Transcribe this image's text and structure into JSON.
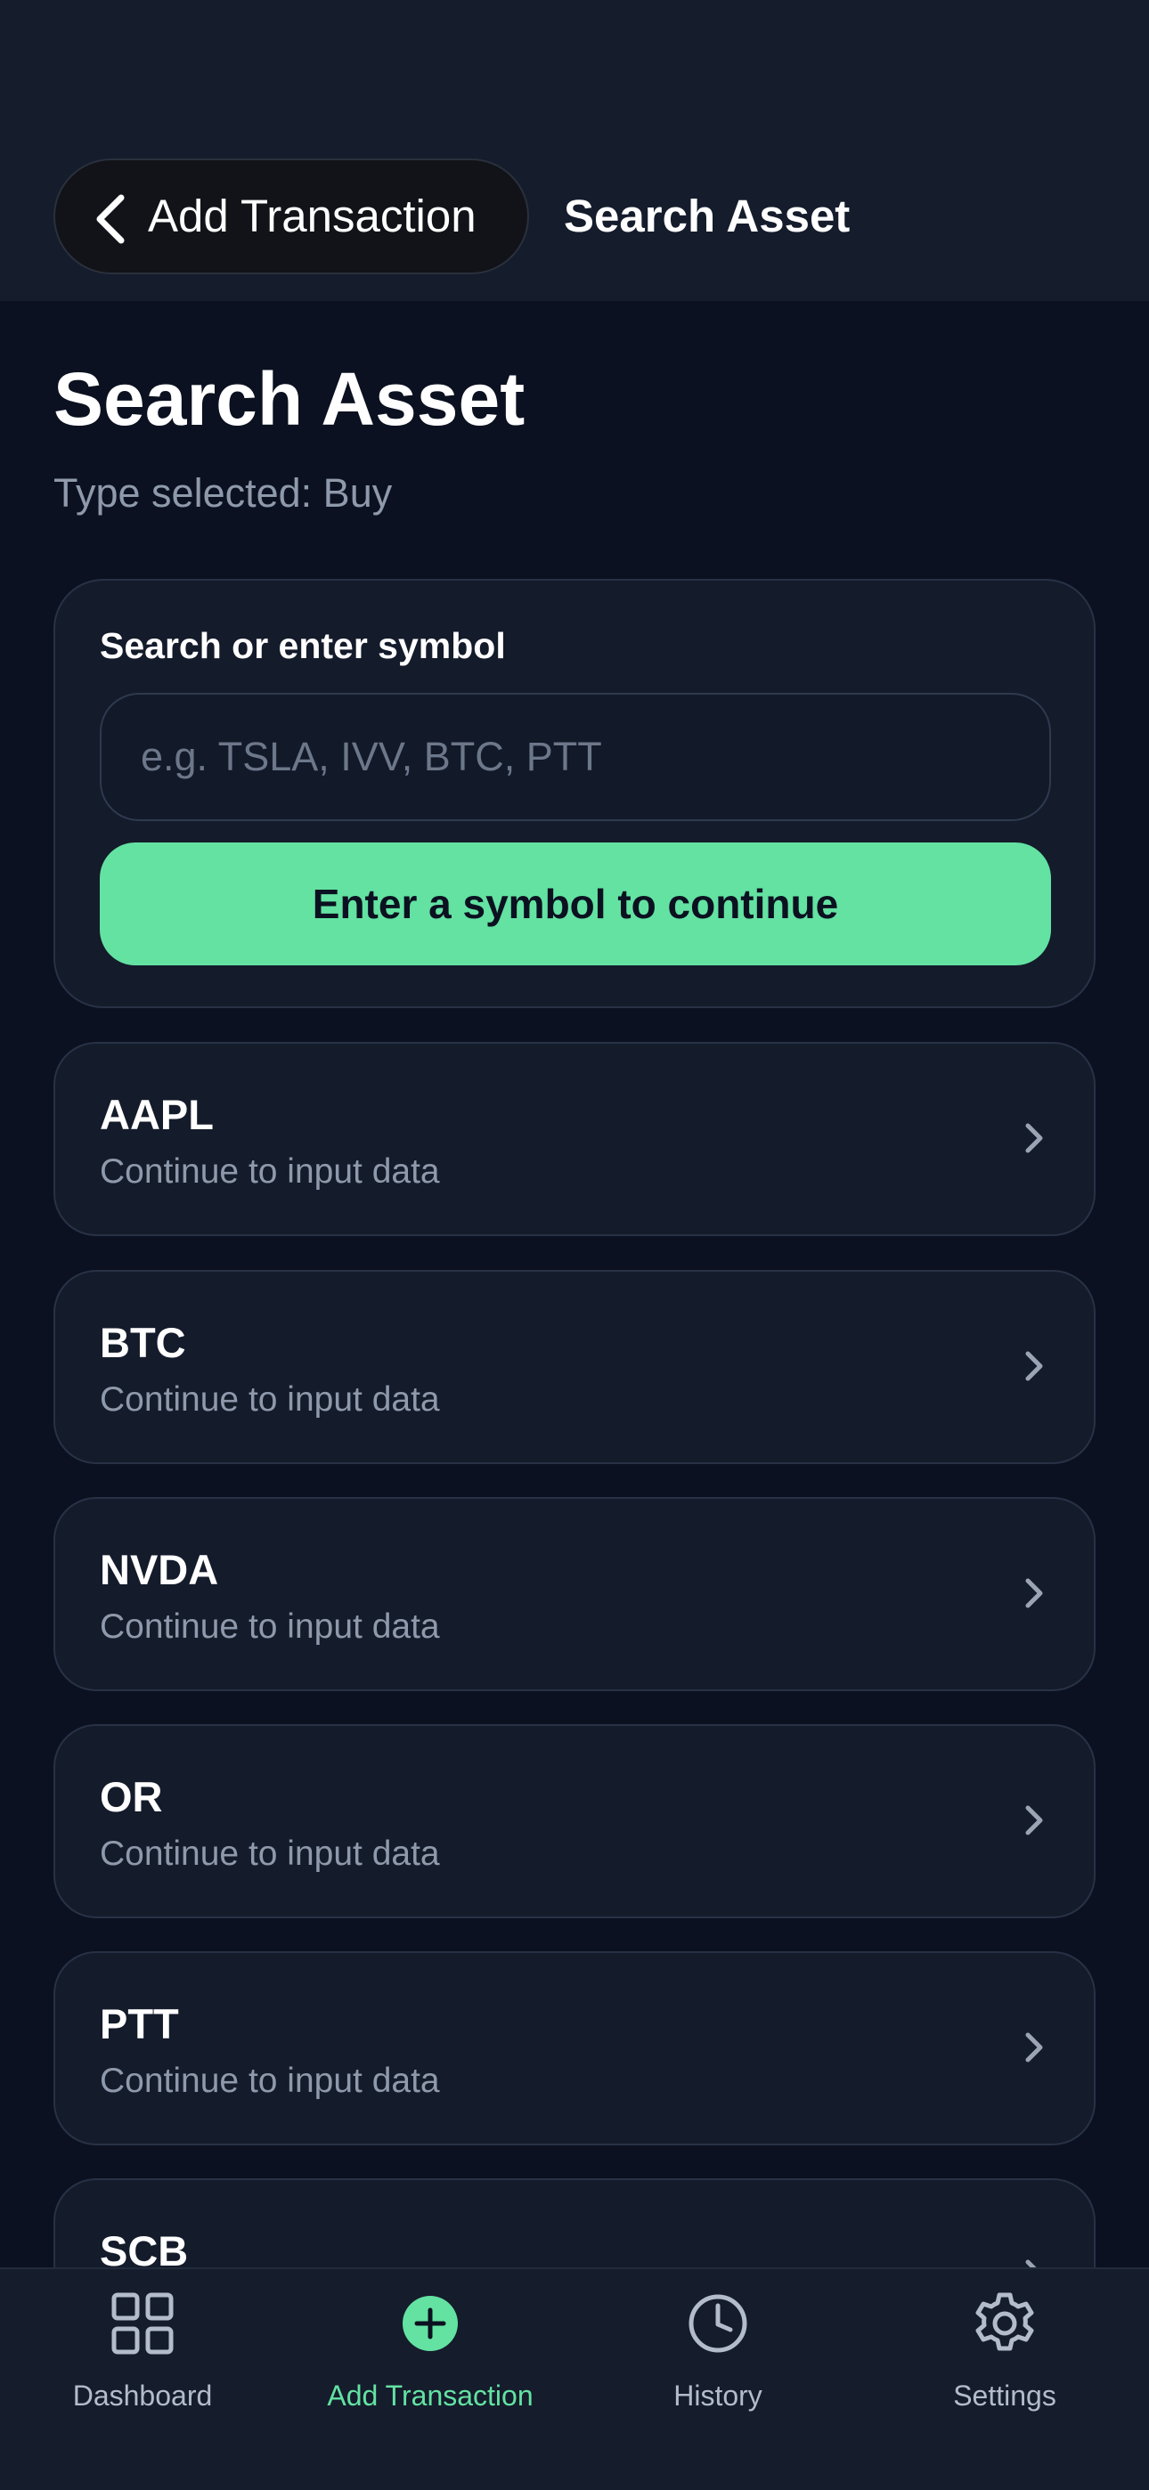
{
  "header": {
    "back_label": "Add Transaction",
    "title": "Search Asset"
  },
  "page": {
    "title": "Search Asset",
    "subtitle": "Type selected: Buy"
  },
  "search": {
    "label": "Search or enter symbol",
    "value": "",
    "placeholder": "e.g. TSLA, IVV, BTC, PTT",
    "button_label": "Enter a symbol to continue"
  },
  "assets": [
    {
      "symbol": "AAPL",
      "caption": "Continue to input data"
    },
    {
      "symbol": "BTC",
      "caption": "Continue to input data"
    },
    {
      "symbol": "NVDA",
      "caption": "Continue to input data"
    },
    {
      "symbol": "OR",
      "caption": "Continue to input data"
    },
    {
      "symbol": "PTT",
      "caption": "Continue to input data"
    },
    {
      "symbol": "SCB",
      "caption": ""
    }
  ],
  "tabs": [
    {
      "label": "Dashboard",
      "icon": "grid-icon",
      "active": false
    },
    {
      "label": "Add Transaction",
      "icon": "plus-circle-icon",
      "active": true
    },
    {
      "label": "History",
      "icon": "clock-icon",
      "active": false
    },
    {
      "label": "Settings",
      "icon": "gear-icon",
      "active": false
    }
  ],
  "colors": {
    "background": "#0b1120",
    "card": "#141b2b",
    "accent": "#63e2a2",
    "muted_text": "#8e99ab"
  }
}
